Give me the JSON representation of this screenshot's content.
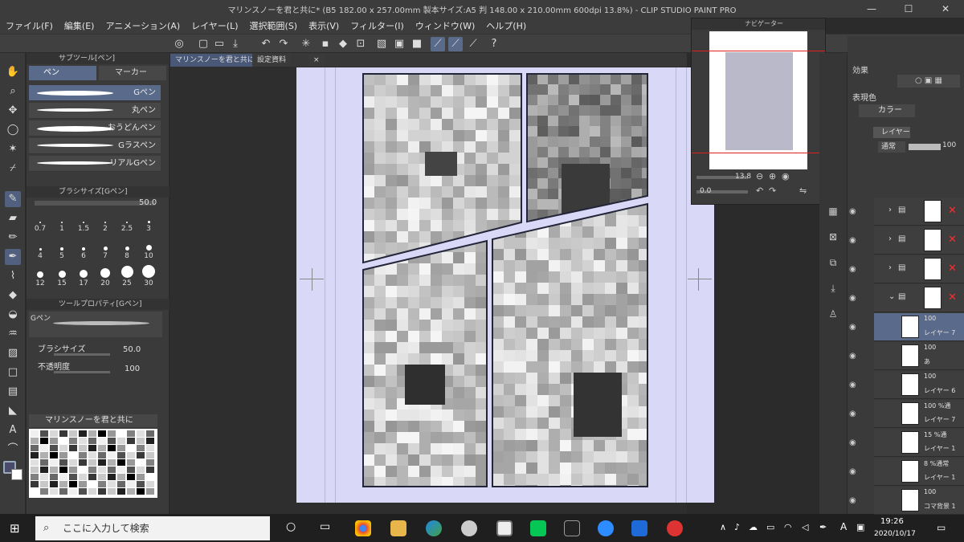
{
  "window": {
    "title": "マリンスノーを君と共に* (B5 182.00 x 257.00mm 製本サイズ:A5 判 148.00 x 210.00mm 600dpi 13.8%) - CLIP STUDIO PAINT PRO",
    "minimize": "—",
    "maximize": "☐",
    "close": "✕"
  },
  "menu": [
    "ファイル(F)",
    "編集(E)",
    "アニメーション(A)",
    "レイヤー(L)",
    "選択範囲(S)",
    "表示(V)",
    "フィルター(I)",
    "ウィンドウ(W)",
    "ヘルプ(H)"
  ],
  "subtool": {
    "header": "サブツール[ペン]",
    "tab_pen": "ペン",
    "tab_marker": "マーカー",
    "brushes": [
      "Gペン",
      "丸ペン",
      "おうどんペン",
      "Gラスペン",
      "リアルGペン"
    ]
  },
  "brush_size": {
    "header": "ブラシサイズ[Gペン]",
    "value": "50.0",
    "sizes": [
      "0.7",
      "1",
      "1.5",
      "2",
      "2.5",
      "3",
      "4",
      "5",
      "6",
      "7",
      "8",
      "10",
      "12",
      "15",
      "17",
      "20",
      "25",
      "30"
    ]
  },
  "tool_property": {
    "header": "ツールプロパティ[Gペン]",
    "name": "Gペン",
    "size_label": "ブラシサイズ",
    "size_value": "50.0",
    "opacity_label": "不透明度",
    "opacity_value": "100"
  },
  "color_set": {
    "name": "マリンスノーを君と共に"
  },
  "doc_tabs": [
    "マリンスノーを君と共に*",
    "設定資料"
  ],
  "navigator": {
    "title": "ナビゲーター",
    "zoom": "13.8",
    "rotation": "0.0"
  },
  "right_panel": {
    "effect_label": "効果",
    "expression_label": "表現色",
    "expression_value": "カラー",
    "layer_tab": "レイヤー",
    "blend_mode": "通常",
    "opacity": "100"
  },
  "layers": [
    {
      "name": "",
      "opacity": "",
      "kind": "folder"
    },
    {
      "name": "",
      "opacity": "",
      "kind": "folder"
    },
    {
      "name": "",
      "opacity": "",
      "kind": "folder"
    },
    {
      "name": "",
      "opacity": "",
      "kind": "folder"
    },
    {
      "name": "レイヤー 7",
      "opacity": "100",
      "kind": "raster"
    },
    {
      "name": "あ",
      "opacity": "100",
      "kind": "text"
    },
    {
      "name": "レイヤー 6",
      "opacity": "100",
      "kind": "raster"
    },
    {
      "name": "レイヤー 7",
      "opacity": "100 %通",
      "kind": "raster"
    },
    {
      "name": "レイヤー 1",
      "opacity": "15 %通",
      "kind": "raster"
    },
    {
      "name": "レイヤー 1",
      "opacity": "8 %通常",
      "kind": "raster"
    },
    {
      "name": "コマ背景 1",
      "opacity": "100",
      "kind": "raster"
    }
  ],
  "taskbar": {
    "search_placeholder": "ここに入力して検索",
    "time": "19:26",
    "date": "2020/10/17",
    "ime": "A"
  },
  "colors": {
    "accent": "#5a6a8a",
    "page": "#d9d9f7",
    "panel_border": "#262a40"
  }
}
